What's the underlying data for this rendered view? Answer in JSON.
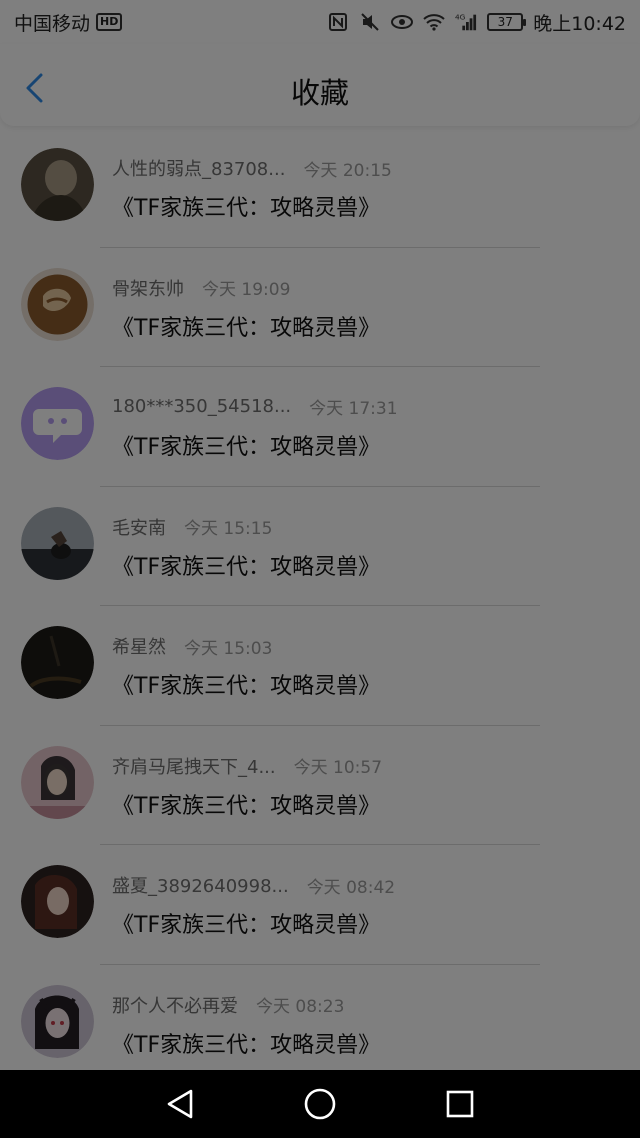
{
  "status_bar": {
    "carrier": "中国移动",
    "hd": "HD",
    "network": "4G",
    "battery": "37",
    "time": "晚上10:42"
  },
  "header": {
    "title": "收藏"
  },
  "items": [
    {
      "name": "人性的弱点_83708...",
      "time": "今天 20:15",
      "content": "《TF家族三代：攻略灵兽》",
      "avatar_color": "#6b6048"
    },
    {
      "name": "骨架东帅",
      "time": "今天 19:09",
      "content": "《TF家族三代：攻略灵兽》",
      "avatar_color": "#c08a4a"
    },
    {
      "name": "180***350_54518...",
      "time": "今天 17:31",
      "content": "《TF家族三代：攻略灵兽》",
      "avatar_color": "#b9a2f0"
    },
    {
      "name": "毛安南",
      "time": "今天 15:15",
      "content": "《TF家族三代：攻略灵兽》",
      "avatar_color": "#4a4f56"
    },
    {
      "name": "希星然",
      "time": "今天 15:03",
      "content": "《TF家族三代：攻略灵兽》",
      "avatar_color": "#222019"
    },
    {
      "name": "齐肩马尾拽天下_4...",
      "time": "今天 10:57",
      "content": "《TF家族三代：攻略灵兽》",
      "avatar_color": "#c9a2a8"
    },
    {
      "name": "盛夏_3892640998...",
      "time": "今天 08:42",
      "content": "《TF家族三代：攻略灵兽》",
      "avatar_color": "#6a4b3e"
    },
    {
      "name": "那个人不必再爱",
      "time": "今天 08:23",
      "content": "《TF家族三代：攻略灵兽》",
      "avatar_color": "#3c3a44"
    }
  ],
  "colors": {
    "accent": "#2f8be6",
    "overlay": "rgba(0,0,0,0.5)"
  }
}
